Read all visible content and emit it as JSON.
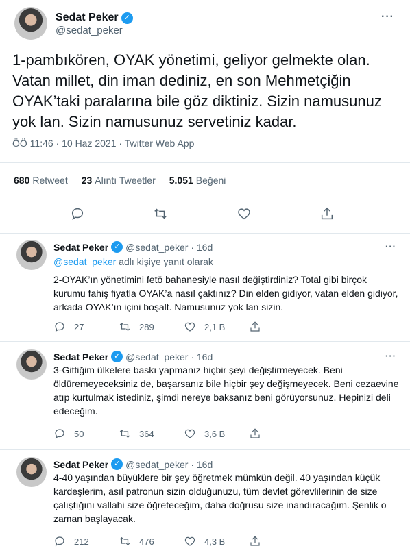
{
  "main": {
    "name": "Sedat Peker",
    "handle": "@sedat_peker",
    "more": "···",
    "text": "1-pambıkören, OYAK yönetimi, geliyor gelmekte olan. Vatan millet, din iman dediniz, en son Mehmetçiğin OYAK’taki paralarına bile göz diktiniz. Sizin namusunuz yok lan. Sizin namusunuz servetiniz kadar.",
    "meta": "ÖÖ 11:46 · 10 Haz 2021 · Twitter Web App",
    "retweets": "680",
    "retweets_label": "Retweet",
    "quotes": "23",
    "quotes_label": "Alıntı Tweetler",
    "likes": "5.051",
    "likes_label": "Beğeni"
  },
  "action_icons": [
    "reply-icon",
    "retweet-icon",
    "like-icon",
    "share-icon"
  ],
  "replies": [
    {
      "name": "Sedat Peker",
      "handle": "@sedat_peker · 16d",
      "reply_to_handle": "@sedat_peker",
      "reply_to_suffix": " adlı kişiye yanıt olarak",
      "text": "2-OYAK’ın yönetimini fetö bahanesiyle nasıl değiştirdiniz? Total gibi birçok kurumu fahiş fiyatla OYAK’a nasıl çaktınız? Din elden gidiyor, vatan elden gidiyor, arkada OYAK’ın içini boşalt. Namusunuz yok lan sizin.",
      "replies": "27",
      "retweets": "289",
      "likes": "2,1 B"
    },
    {
      "name": "Sedat Peker",
      "handle": "@sedat_peker · 16d",
      "text": "3-Gittiğim ülkelere baskı yapmanız hiçbir şeyi değiştirmeyecek. Beni öldüremeyeceksiniz de, başarsanız bile hiçbir şey değişmeyecek. Beni cezaevine atıp kurtulmak istediniz, şimdi nereye baksanız beni görüyorsunuz. Hepinizi deli edeceğim.",
      "replies": "50",
      "retweets": "364",
      "likes": "3,6 B"
    },
    {
      "name": "Sedat Peker",
      "handle": "@sedat_peker · 16d",
      "text": "4-40 yaşından büyüklere bir şey öğretmek mümkün değil. 40 yaşından küçük kardeşlerim, asıl patronun sizin olduğunuzu, tüm devlet görevlilerinin de size çalıştığını vallahi size öğreteceğim, daha doğrusu size inandıracağım. Şenlik o zaman başlayacak.",
      "replies": "212",
      "retweets": "476",
      "likes": "4,3 B"
    }
  ],
  "colors": {
    "accent": "#1d9bf0",
    "muted": "#536471",
    "text": "#0f1419",
    "divider": "#e1e8ed"
  }
}
